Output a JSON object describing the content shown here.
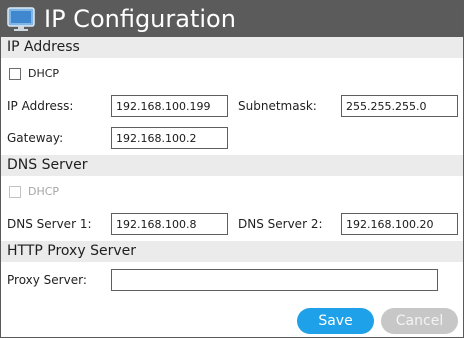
{
  "window": {
    "title": "IP Configuration",
    "icon": "network-monitor-icon"
  },
  "ip_address": {
    "section_title": "IP Address",
    "dhcp": {
      "label": "DHCP",
      "checked": false,
      "enabled": true
    },
    "ip_label": "IP Address:",
    "ip_value": "192.168.100.199",
    "subnet_label": "Subnetmask:",
    "subnet_value": "255.255.255.0",
    "gateway_label": "Gateway:",
    "gateway_value": "192.168.100.2"
  },
  "dns_server": {
    "section_title": "DNS Server",
    "dhcp": {
      "label": "DHCP",
      "checked": false,
      "enabled": false
    },
    "dns1_label": "DNS Server 1:",
    "dns1_value": "192.168.100.8",
    "dns2_label": "DNS Server 2:",
    "dns2_value": "192.168.100.20"
  },
  "http_proxy": {
    "section_title": "HTTP Proxy Server",
    "proxy_label": "Proxy Server:",
    "proxy_value": ""
  },
  "buttons": {
    "save_label": "Save",
    "cancel_label": "Cancel"
  },
  "colors": {
    "titlebar": "#5b5b5b",
    "section_header": "#ebebeb",
    "save_button": "#1ea1e8",
    "cancel_button": "#c7c7c7"
  }
}
